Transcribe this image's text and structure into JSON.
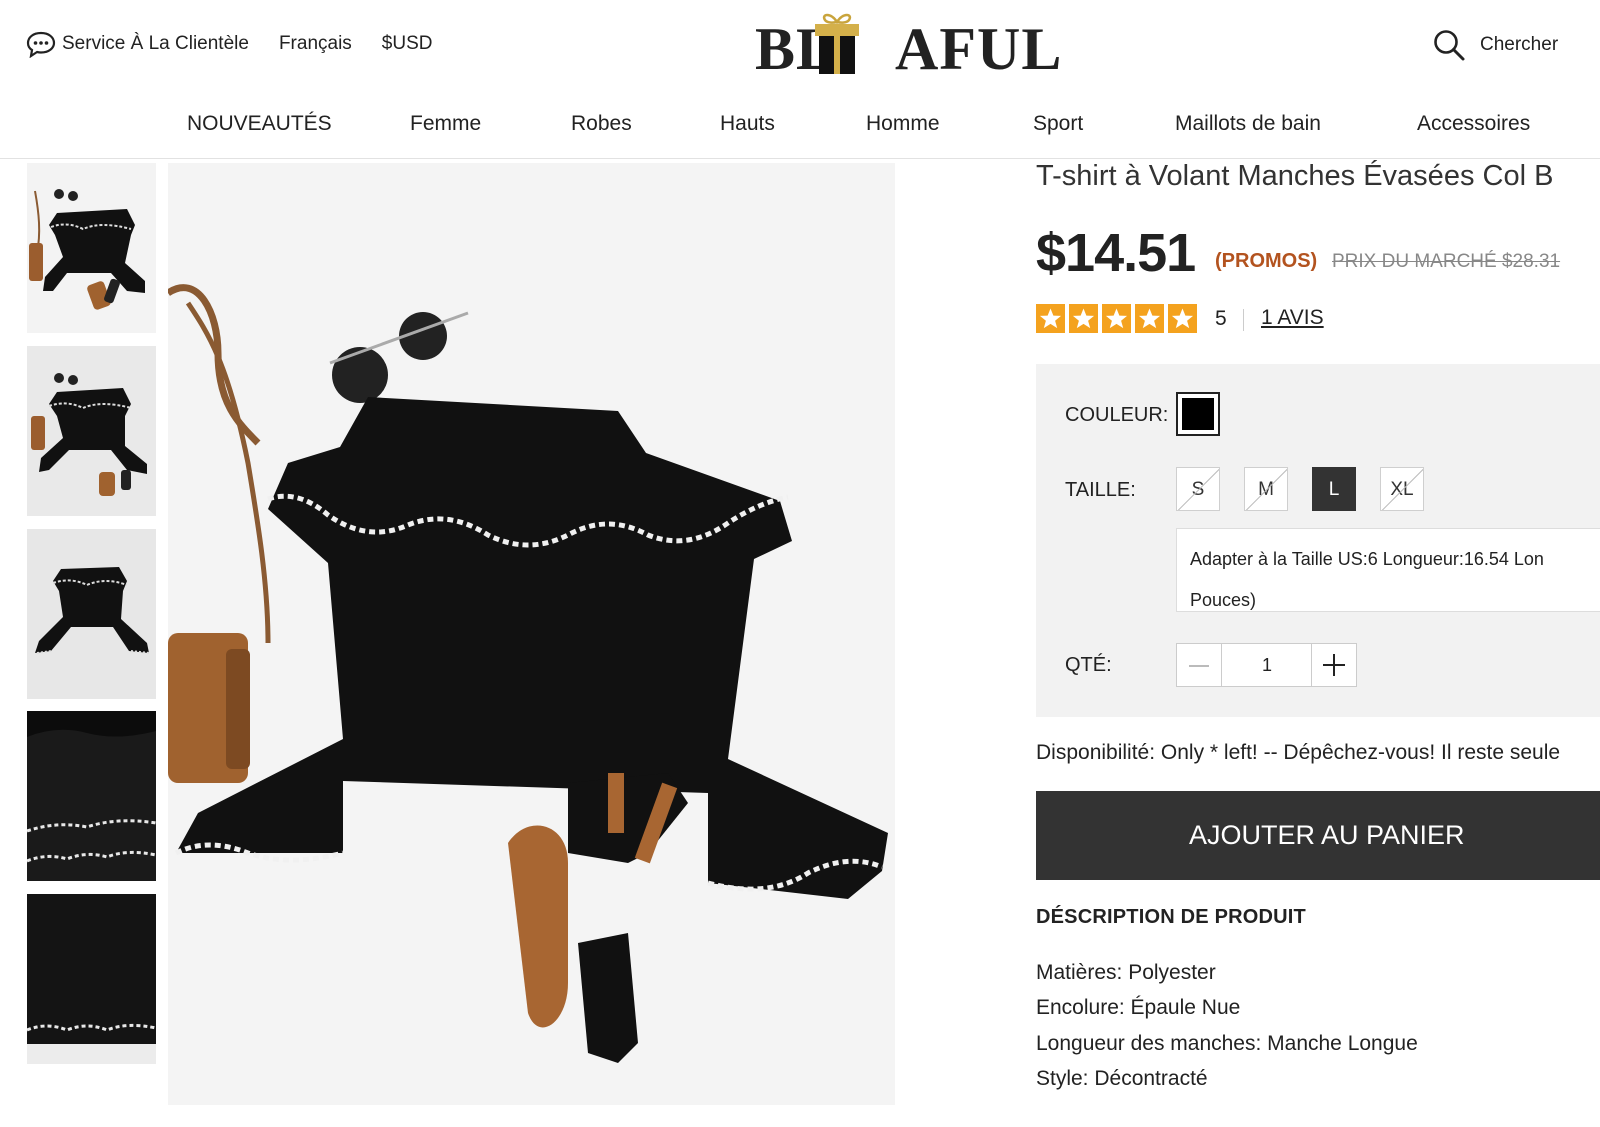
{
  "header": {
    "customer_service": "Service À La Clientèle",
    "language": "Français",
    "currency": "$USD",
    "logo_prefix": "BL",
    "logo_suffix": "AFUL",
    "search_label": "Chercher"
  },
  "nav": {
    "items": [
      "NOUVEAUTÉS",
      "Femme",
      "Robes",
      "Hauts",
      "Homme",
      "Sport",
      "Maillots de bain",
      "Accessoires"
    ]
  },
  "product": {
    "title": "T-shirt à Volant Manches Évasées Col B",
    "price": "$14.51",
    "promo_label": "(PROMOS)",
    "market_price": "PRIX DU MARCHÉ $28.31",
    "rating": 5,
    "rating_text": "5",
    "reviews_link": "1 AVIS",
    "color_label": "COULEUR:",
    "color_value": "#000000",
    "size_label": "TAILLE:",
    "sizes": [
      "S",
      "M",
      "L",
      "XL"
    ],
    "selected_size": "L",
    "size_info_line1": "Adapter à la Taille US:6   Longueur:16.54   Lon",
    "size_info_line2": "Pouces)",
    "qty_label": "QTÉ:",
    "quantity": "1",
    "availability": "Disponibilité: Only * left! -- Dépêchez-vous! Il reste seule",
    "add_to_cart": "AJOUTER AU PANIER",
    "description_title": "DÉSCRIPTION DE PRODUIT",
    "description": [
      "Matières: Polyester",
      "Encolure: Épaule Nue",
      "Longueur des manches: Manche Longue",
      "Style: Décontracté"
    ]
  },
  "colors": {
    "price_promo": "#b3531f",
    "star": "#f4a21e",
    "button_bg": "#333333",
    "options_bg": "#f2f2f2"
  },
  "icons": [
    "chat-bubble-icon",
    "gift-box-icon",
    "search-icon",
    "star-icon",
    "minus-icon",
    "plus-icon"
  ]
}
